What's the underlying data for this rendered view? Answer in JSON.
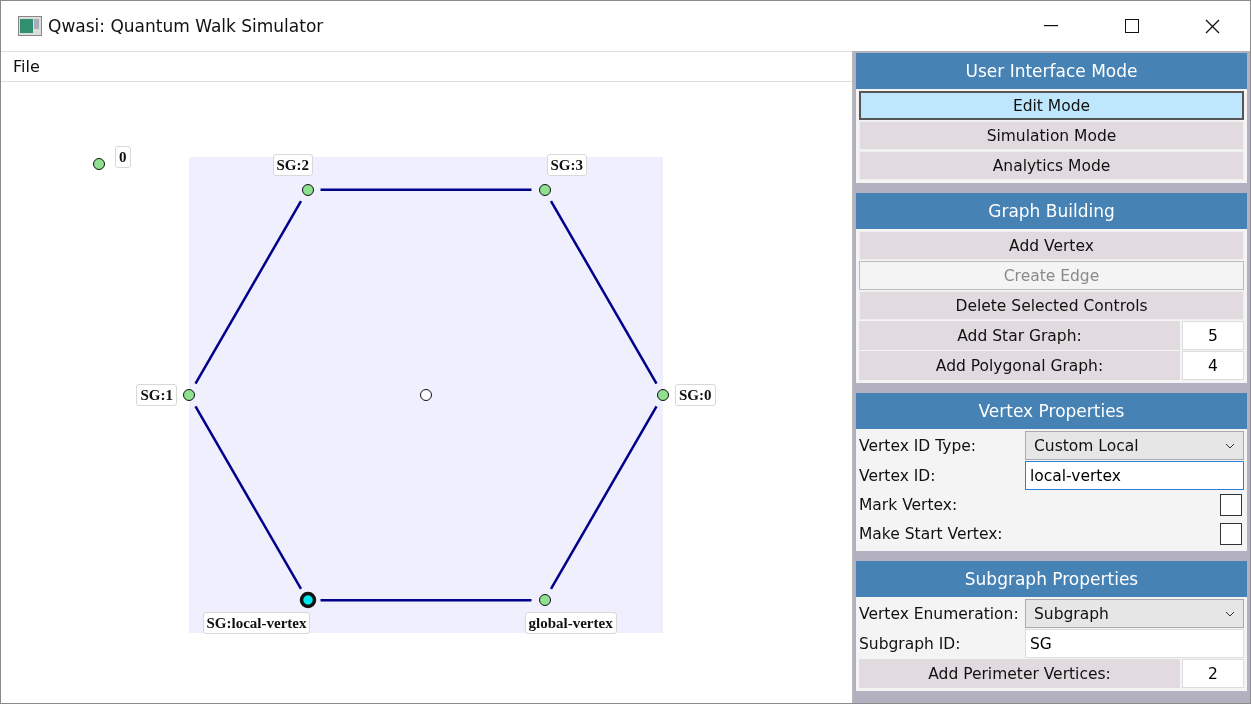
{
  "window": {
    "title": "Qwasi: Quantum Walk Simulator"
  },
  "menu": [
    {
      "label": "File"
    }
  ],
  "canvas": {
    "free_vertices": [
      {
        "label": "0",
        "selected": false
      }
    ],
    "subgraph": {
      "hub": {
        "kind": "hub"
      },
      "ring": [
        {
          "label": "SG:0",
          "selected": false
        },
        {
          "label": "SG:3",
          "selected": false
        },
        {
          "label": "SG:2",
          "selected": false
        },
        {
          "label": "SG:1",
          "selected": false
        },
        {
          "label": "SG:local-vertex",
          "selected": true
        },
        {
          "label": "global-vertex",
          "selected": false
        }
      ]
    }
  },
  "panel": [
    {
      "title": "User Interface Mode",
      "rows": [
        {
          "kind": "button",
          "label": "Edit Mode",
          "selected": true,
          "disabled": false
        },
        {
          "kind": "button",
          "label": "Simulation Mode",
          "selected": false,
          "disabled": false
        },
        {
          "kind": "button",
          "label": "Analytics Mode",
          "selected": false,
          "disabled": false
        }
      ]
    },
    {
      "title": "Graph Building",
      "rows": [
        {
          "kind": "button",
          "label": "Add Vertex",
          "selected": false,
          "disabled": false
        },
        {
          "kind": "button",
          "label": "Create Edge",
          "selected": false,
          "disabled": true
        },
        {
          "kind": "button",
          "label": "Delete Selected Controls",
          "selected": false,
          "disabled": false
        },
        {
          "kind": "number",
          "label": "Add Star Graph:",
          "value": "5"
        },
        {
          "kind": "number",
          "label": "Add Polygonal Graph:",
          "value": "4"
        }
      ]
    },
    {
      "title": "Vertex Properties",
      "rows": [
        {
          "kind": "select",
          "label": "Vertex ID Type:",
          "value": "Custom Local"
        },
        {
          "kind": "text",
          "label": "Vertex ID:",
          "value": "local-vertex",
          "focused": true
        },
        {
          "kind": "checkbox",
          "label": "Mark Vertex:",
          "checked": false
        },
        {
          "kind": "checkbox",
          "label": "Make Start Vertex:",
          "checked": false
        }
      ]
    },
    {
      "title": "Subgraph Properties",
      "rows": [
        {
          "kind": "select",
          "label": "Vertex Enumeration:",
          "value": "Subgraph"
        },
        {
          "kind": "text",
          "label": "Subgraph ID:",
          "value": "SG",
          "focused": false
        },
        {
          "kind": "number",
          "label": "Add Perimeter Vertices:",
          "value": "2"
        }
      ]
    }
  ]
}
